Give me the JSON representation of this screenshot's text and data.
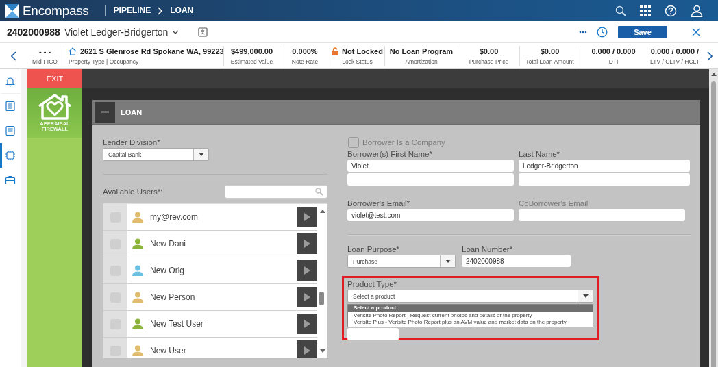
{
  "top_bar": {
    "brand": "Encompass",
    "breadcrumb": [
      {
        "label": "PIPELINE",
        "selected": false
      },
      {
        "label": "LOAN",
        "selected": true
      }
    ]
  },
  "header": {
    "loan_number": "2402000988",
    "borrower_name": "Violet Ledger-Bridgerton",
    "save_button": "Save"
  },
  "info_strip": [
    {
      "kind": "plain",
      "value": "- - -",
      "label": "Mid-FICO"
    },
    {
      "kind": "home",
      "value": "2621 S Glenrose Rd Spokane WA, 99223",
      "label": "Property Type | Occupancy"
    },
    {
      "kind": "plain",
      "value": "$499,000.00",
      "label": "Estimated Value"
    },
    {
      "kind": "plain",
      "value": "0.000%",
      "label": "Note Rate"
    },
    {
      "kind": "lock",
      "value": "Not Locked",
      "label": "Lock Status"
    },
    {
      "kind": "plain",
      "value": "No Loan Program",
      "label": "Amortization"
    },
    {
      "kind": "plain",
      "value": "$0.00",
      "label": "Purchase Price"
    },
    {
      "kind": "plain",
      "value": "$0.00",
      "label": "Total Loan Amount"
    },
    {
      "kind": "plain",
      "value": "0.000 / 0.000",
      "label": "DTI"
    },
    {
      "kind": "plain",
      "value": "0.000 / 0.000 /",
      "label": "LTV / CLTV / HCLT"
    }
  ],
  "side_rail": [
    {
      "kind": "bell",
      "selected": false
    },
    {
      "kind": "list",
      "selected": false
    },
    {
      "kind": "document",
      "selected": false
    },
    {
      "kind": "chip",
      "selected": true
    },
    {
      "kind": "briefcase",
      "selected": false
    }
  ],
  "app": {
    "exit": "EXIT",
    "logo_lines": [
      "APPRAISAL",
      "FIREWALL"
    ]
  },
  "panel": {
    "title": "LOAN",
    "expanded": true,
    "lender_division": {
      "label": "Lender Division*",
      "value": "Capital Bank"
    },
    "available_users": {
      "label": "Available Users*:",
      "users": [
        {
          "name": "my@rev.com",
          "color": "#e0bd6e",
          "checked": false
        },
        {
          "name": "New Dani",
          "color": "#8cb33c",
          "checked": false
        },
        {
          "name": "New Orig",
          "color": "#6cbfe0",
          "checked": false
        },
        {
          "name": "New Person",
          "color": "#e0bd6e",
          "checked": false
        },
        {
          "name": "New Test User",
          "color": "#8cb33c",
          "checked": false
        },
        {
          "name": "New User",
          "color": "#e0bd6e",
          "checked": false
        }
      ]
    },
    "borrower_is_company": {
      "label": "Borrower Is a Company",
      "checked": false,
      "disabled": true
    },
    "name_fields": [
      {
        "label": "Borrower(s) First Name*",
        "value": "Violet"
      },
      {
        "label": "Last Name*",
        "value": "Ledger-Bridgerton"
      }
    ],
    "email_fields": [
      {
        "label": "Borrower's Email*",
        "value": "violet@test.com",
        "disabled": false
      },
      {
        "label": "CoBorrower's Email",
        "disabled": true
      }
    ],
    "loan_purpose": {
      "label": "Loan Purpose*",
      "value": "Purchase"
    },
    "loan_number": {
      "label": "Loan Number*",
      "value": "2402000988"
    },
    "product_type": {
      "label": "Product Type*",
      "value": "Select a product",
      "expanded": true,
      "highlighted": true,
      "options": [
        {
          "label": "Select a product",
          "selected": true
        },
        {
          "label": "Verisite Photo Report - Request current photos and details of the property",
          "selected": false
        },
        {
          "label": "Verisite Plus - Verisite Photo Report plus an AVM value and market data on the property",
          "selected": false
        }
      ]
    }
  }
}
